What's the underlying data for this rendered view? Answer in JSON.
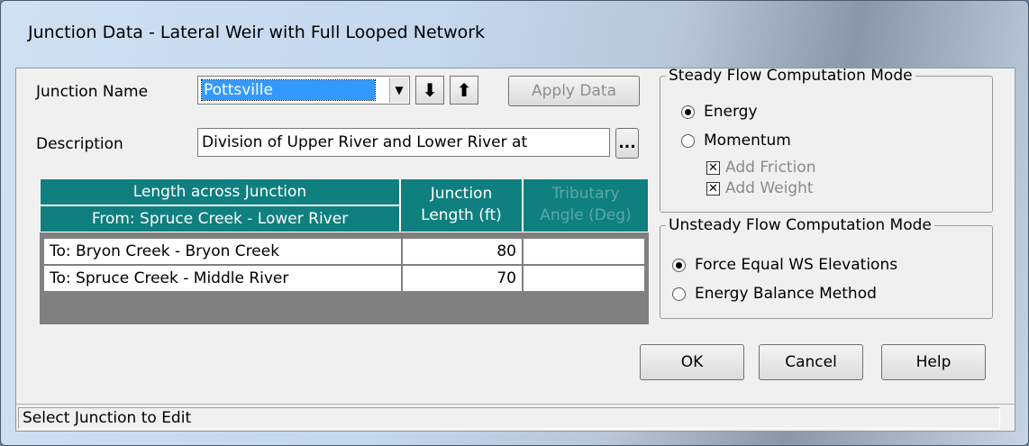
{
  "window": {
    "title": "Junction Data - Lateral Weir with Full Looped Network"
  },
  "junction_name": {
    "label": "Junction Name",
    "value": "Pottsville",
    "down_arrow": "⬇",
    "up_arrow": "⬆"
  },
  "apply_button": "Apply Data",
  "description": {
    "label": "Description",
    "value": "Division of Upper River and Lower River at",
    "browse": "..."
  },
  "table": {
    "header_length": "Length across Junction",
    "header_from": "From: Spruce Creek - Lower River",
    "header_junction_1": "Junction",
    "header_junction_2": "Length (ft)",
    "header_angle_1": "Tributary",
    "header_angle_2": "Angle (Deg)",
    "rows": [
      {
        "to": "To: Bryon Creek - Bryon Creek",
        "length": "80",
        "angle": ""
      },
      {
        "to": "To: Spruce Creek - Middle River",
        "length": "70",
        "angle": ""
      }
    ]
  },
  "steady": {
    "title": "Steady Flow Computation Mode",
    "energy": "Energy",
    "momentum": "Momentum",
    "add_friction": "Add Friction",
    "add_weight": "Add Weight",
    "selected": "Energy"
  },
  "unsteady": {
    "title": "Unsteady Flow Computation Mode",
    "force_equal": "Force Equal WS Elevations",
    "energy_balance": "Energy Balance Method",
    "selected": "Force Equal WS Elevations"
  },
  "buttons": {
    "ok": "OK",
    "cancel": "Cancel",
    "help": "Help"
  },
  "status": "Select Junction to Edit"
}
